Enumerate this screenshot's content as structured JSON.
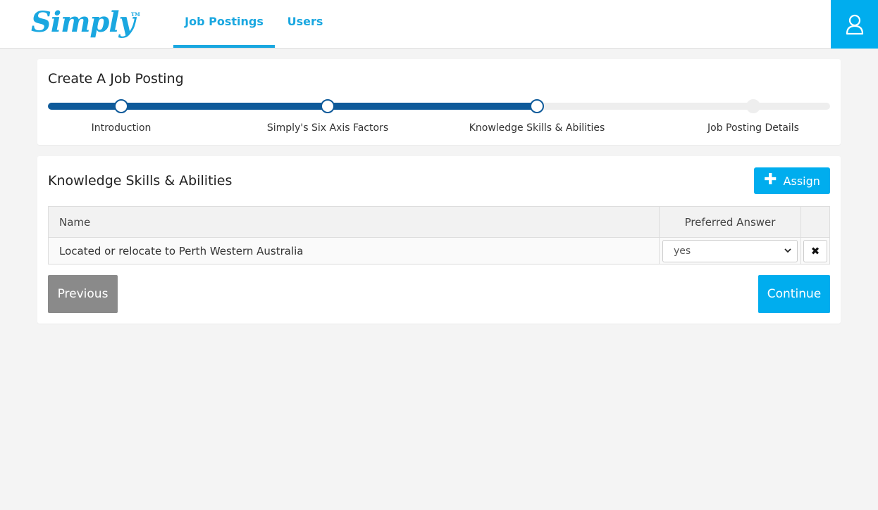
{
  "app": {
    "logo_text": "Simply",
    "logo_mark": "TM"
  },
  "nav": {
    "tabs": [
      {
        "label": "Job Postings",
        "active": true
      },
      {
        "label": "Users",
        "active": false
      }
    ],
    "user_icon": "user-icon"
  },
  "wizard": {
    "title": "Create A Job Posting",
    "steps": [
      {
        "label": "Introduction",
        "state": "complete"
      },
      {
        "label": "Simply's Six Axis Factors",
        "state": "complete"
      },
      {
        "label": "Knowledge Skills & Abilities",
        "state": "current"
      },
      {
        "label": "Job Posting Details",
        "state": "pending"
      }
    ]
  },
  "ksa": {
    "title": "Knowledge Skills & Abilities",
    "assign_label": "Assign",
    "assign_icon": "plus-icon",
    "columns": {
      "name": "Name",
      "preferred": "Preferred Answer"
    },
    "rows": [
      {
        "name": "Located or relocate to Perth Western Australia",
        "preferred": "yes",
        "remove_icon": "close-icon"
      }
    ],
    "previous_label": "Previous",
    "continue_label": "Continue"
  },
  "colors": {
    "accent": "#00adee",
    "progress": "#0e5a9a",
    "secondary_button": "#8a8a8a"
  }
}
